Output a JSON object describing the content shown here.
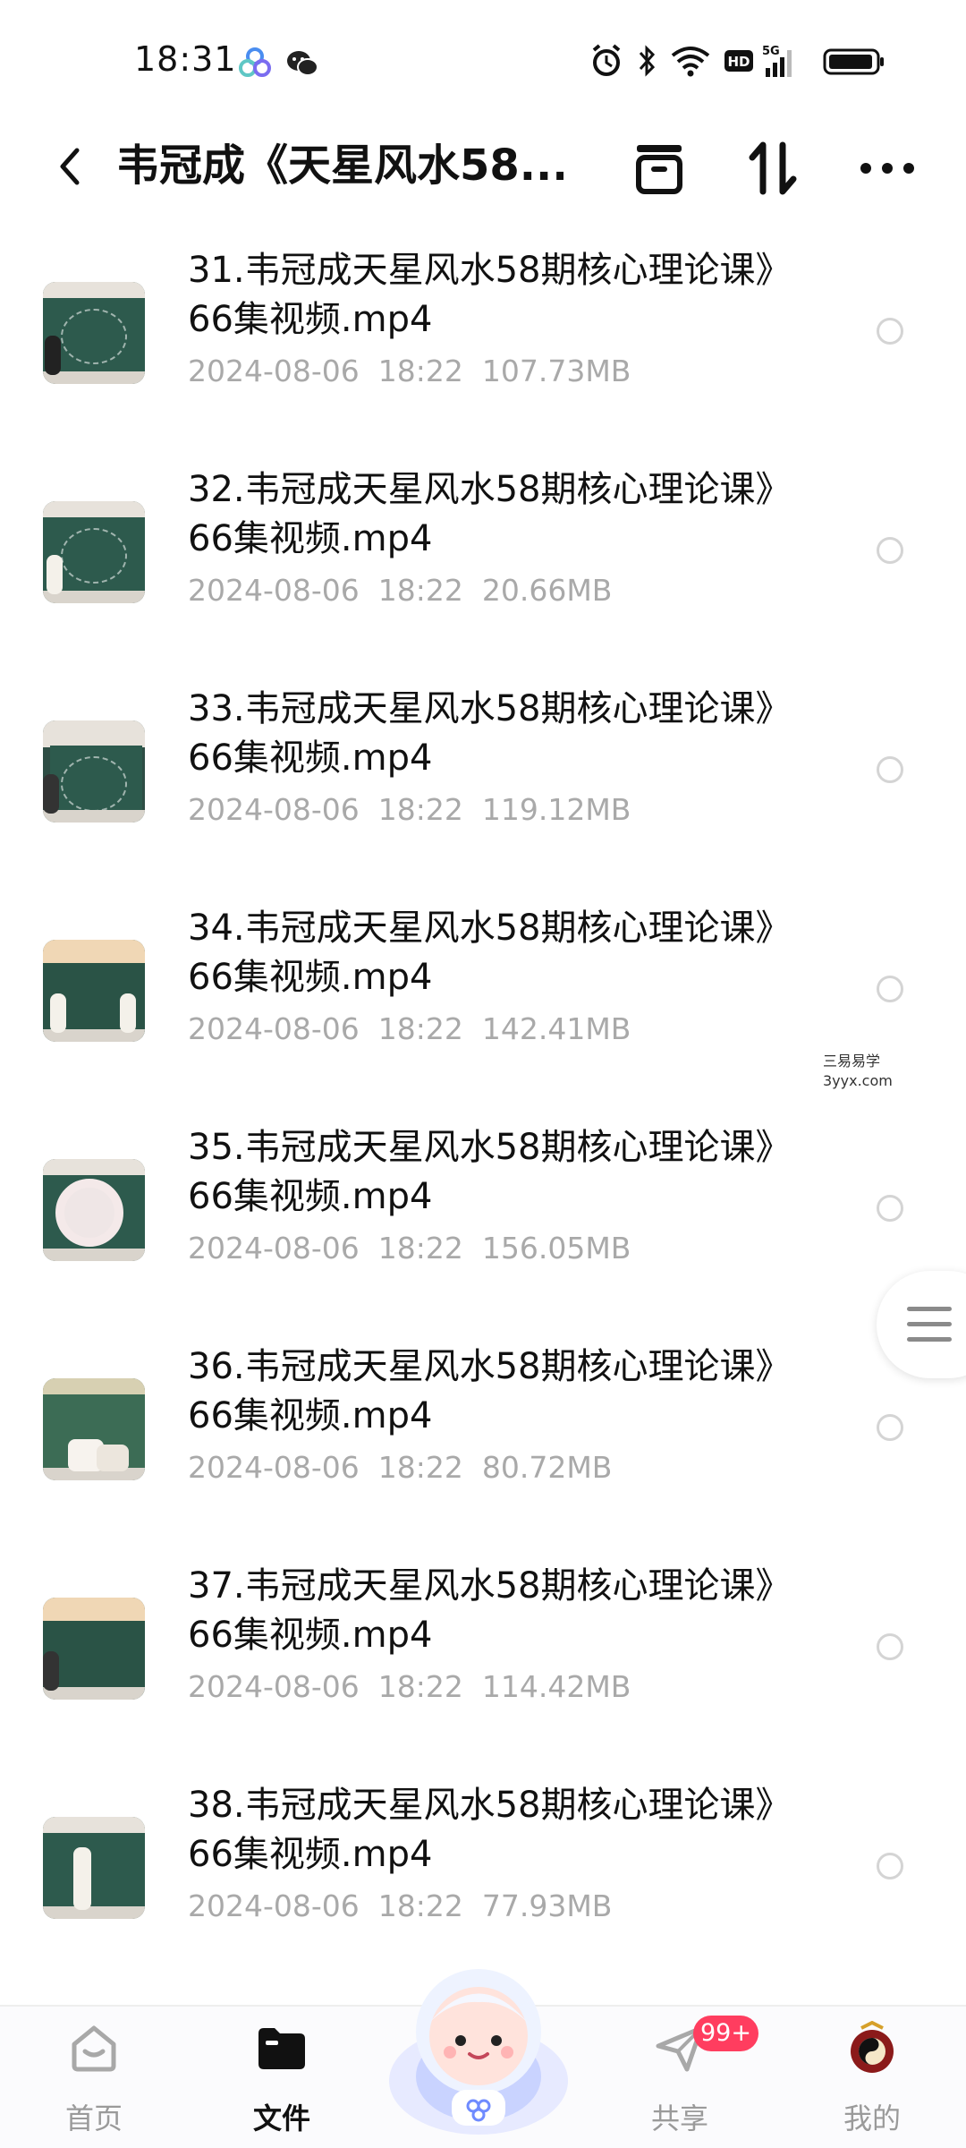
{
  "status_bar": {
    "time": "18:31",
    "network": "5G",
    "hd_label": "HD",
    "icons": [
      "baidu-netdisk-icon",
      "wechat-icon",
      "alarm-icon",
      "bluetooth-icon",
      "wifi-icon",
      "signal-icon",
      "battery-icon"
    ]
  },
  "header": {
    "title": "韦冠成《天星风水58...",
    "icons": [
      "back-icon",
      "tray-icon",
      "sort-icon",
      "more-icon"
    ]
  },
  "files": [
    {
      "name": "31.韦冠成天星风水58期核心理论课》66集视频.mp4",
      "date": "2024-08-06",
      "time": "18:22",
      "size": "107.73MB"
    },
    {
      "name": "32.韦冠成天星风水58期核心理论课》66集视频.mp4",
      "date": "2024-08-06",
      "time": "18:22",
      "size": "20.66MB"
    },
    {
      "name": "33.韦冠成天星风水58期核心理论课》66集视频.mp4",
      "date": "2024-08-06",
      "time": "18:22",
      "size": "119.12MB"
    },
    {
      "name": "34.韦冠成天星风水58期核心理论课》66集视频.mp4",
      "date": "2024-08-06",
      "time": "18:22",
      "size": "142.41MB"
    },
    {
      "name": "35.韦冠成天星风水58期核心理论课》66集视频.mp4",
      "date": "2024-08-06",
      "time": "18:22",
      "size": "156.05MB"
    },
    {
      "name": "36.韦冠成天星风水58期核心理论课》66集视频.mp4",
      "date": "2024-08-06",
      "time": "18:22",
      "size": "80.72MB"
    },
    {
      "name": "37.韦冠成天星风水58期核心理论课》66集视频.mp4",
      "date": "2024-08-06",
      "time": "18:22",
      "size": "114.42MB"
    },
    {
      "name": "38.韦冠成天星风水58期核心理论课》66集视频.mp4",
      "date": "2024-08-06",
      "time": "18:22",
      "size": "77.93MB"
    }
  ],
  "watermark": {
    "line1": "三易易学",
    "line2": "3yyx.com"
  },
  "bottom_nav": {
    "items": [
      {
        "label": "首页",
        "icon": "home-icon"
      },
      {
        "label": "文件",
        "icon": "folder-icon",
        "active": true
      },
      {
        "label": "",
        "icon": "mascot-icon"
      },
      {
        "label": "共享",
        "icon": "send-icon",
        "badge": "99+"
      },
      {
        "label": "我的",
        "icon": "avatar-icon"
      }
    ]
  },
  "colors": {
    "accent": "#ff3d5f",
    "meta_text": "#a9a9a9",
    "title_text": "#111111"
  }
}
